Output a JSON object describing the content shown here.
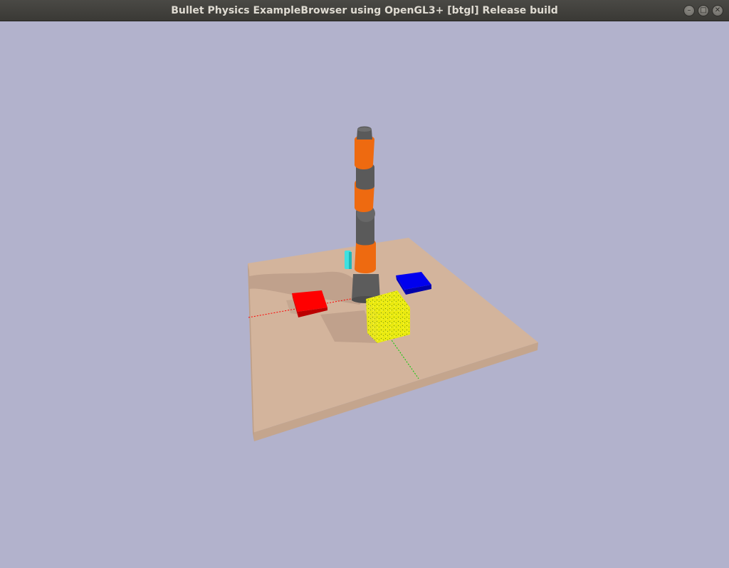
{
  "window": {
    "title": "Bullet Physics ExampleBrowser using OpenGL3+ [btgl] Release build",
    "controls": [
      "minimize-icon",
      "maximize-icon",
      "close-icon"
    ]
  },
  "viewport": {
    "background": "#b2b2cc",
    "scene": {
      "plane_color": "#d3b49c",
      "robot_colors": {
        "orange": "#ee6a10",
        "gray": "#5a5a5a"
      },
      "objects": [
        {
          "name": "red-tray",
          "color": "#ff0000"
        },
        {
          "name": "blue-tray",
          "color": "#0000ee"
        },
        {
          "name": "yellow-cube",
          "color": "#eaea10"
        },
        {
          "name": "cyan-block",
          "color": "#40e0e0"
        }
      ],
      "axes": {
        "x_color": "#ff0000",
        "y_color": "#00cc00"
      }
    }
  }
}
